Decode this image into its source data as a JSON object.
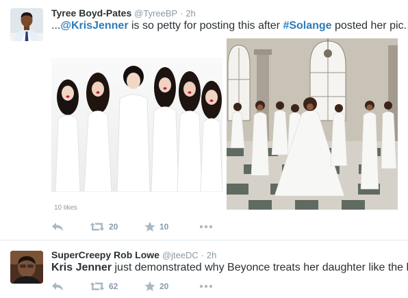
{
  "tweets": [
    {
      "author": {
        "fullname": "Tyree Boyd-Pates",
        "handle": "@TyreeBP",
        "time": "2h"
      },
      "text": {
        "prefix": "...",
        "mention": "@KrisJenner",
        "mid": " is so petty for posting this after ",
        "hashtag": "#Solange",
        "suffix": " posted her pic."
      },
      "media_peek_text": "10 likes",
      "actions": {
        "retweet_count": "20",
        "favorite_count": "10"
      }
    },
    {
      "author": {
        "fullname": "SuperCreepy Rob Lowe",
        "handle": "@jteeDC",
        "time": "2h"
      },
      "text": {
        "lead": "Kris Jenner",
        "rest": " just demonstrated why Beyonce treats her daughter like the help."
      },
      "actions": {
        "retweet_count": "62",
        "favorite_count": "20"
      }
    }
  ],
  "separator": "·",
  "colors": {
    "link": "#2b7bb9",
    "text": "#292f33",
    "muted": "#8899a6",
    "divider": "#e1e8ed",
    "action_icon": "#aab8c2"
  },
  "icons": {
    "reply": "reply-icon",
    "retweet": "retweet-icon",
    "favorite": "star-icon",
    "more": "more-dots-icon"
  }
}
